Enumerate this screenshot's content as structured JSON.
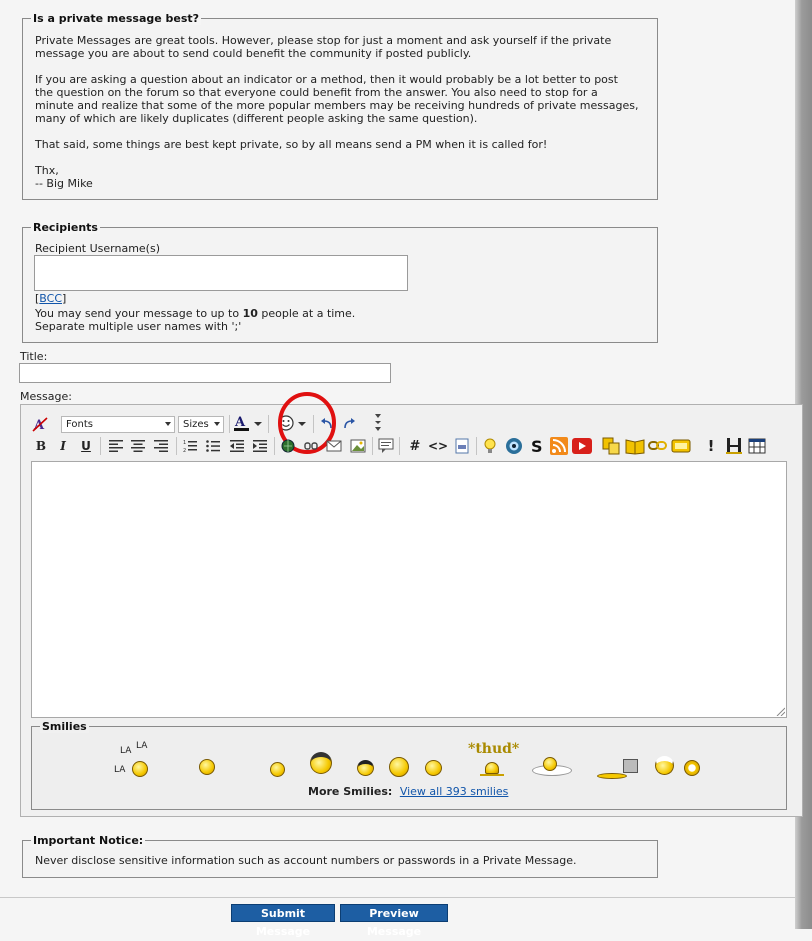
{
  "private_message_notice": {
    "legend": "Is a private message best?",
    "paragraphs": [
      "Private Messages are great tools. However, please stop for just a moment and ask yourself if the private\nmessage you are about to send could benefit the community if posted publicly.",
      "If you are asking a question about an indicator or a method, then it would probably be a lot better to post\nthe question on the forum so that everyone could benefit from the answer. You also need to stop for a\nminute and realize that some of the more popular members may be receiving hundreds of private messages,\nmany of which are likely duplicates (different people asking the same question).",
      "That said, some things are best kept private, so by all means send a PM when it is called for!",
      "Thx,\n-- Big Mike"
    ]
  },
  "recipients": {
    "legend": "Recipients",
    "username_label": "Recipient Username(s)",
    "username_value": "",
    "bcc_link": "BCC",
    "limit_text_pre": "You may send your message to up to ",
    "limit_count": "10",
    "limit_text_post": " people at a time.",
    "separator_hint": "Separate multiple user names with ';'"
  },
  "title_field": {
    "label": "Title:",
    "value": ""
  },
  "message_field": {
    "label": "Message:",
    "value": ""
  },
  "toolbar": {
    "font_select": "Fonts",
    "size_select": "Sizes",
    "bold": "B",
    "italic": "I",
    "underline": "U",
    "hash": "#",
    "code": "<>",
    "exclaim": "!"
  },
  "smilies": {
    "legend": "Smilies",
    "la_text": "LA",
    "thud_text": "*thud*",
    "more_label": "More Smilies:",
    "view_all_link": "View all 393 smilies"
  },
  "important_notice": {
    "legend": "Important Notice:",
    "text": "Never disclose sensitive information such as account numbers or passwords in a Private Message."
  },
  "actions": {
    "submit_label": "Submit Message",
    "preview_label": "Preview Message"
  },
  "colors": {
    "highlight_circle": "#e01010",
    "button_blue": "#1d5ea3",
    "link": "#1155aa"
  }
}
